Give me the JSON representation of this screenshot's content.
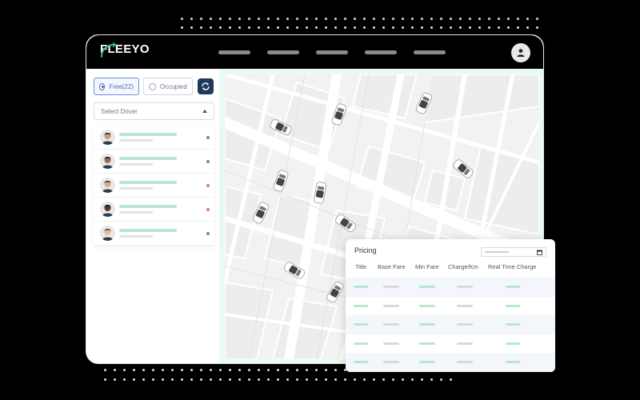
{
  "brand": {
    "name": "FLEEYO",
    "accent": "#2fbf8f"
  },
  "nav": {
    "item_count": 5
  },
  "sidebar": {
    "filters": [
      {
        "label": "Free(22)",
        "selected": true
      },
      {
        "label": "Occupied",
        "selected": false
      }
    ],
    "refresh_icon": "refresh-icon",
    "select_driver": {
      "placeholder": "Select Driver",
      "icon": "caret-up-icon"
    },
    "drivers": [
      {
        "status": "free",
        "status_color": "#4caf50",
        "skin": "#c69c7a",
        "hair": "#2b2118"
      },
      {
        "status": "free",
        "status_color": "#4caf50",
        "skin": "#9c6e4f",
        "hair": "#1a1410"
      },
      {
        "status": "occupied",
        "status_color": "#e57373",
        "skin": "#d8b090",
        "hair": "#3a2a1e"
      },
      {
        "status": "occupied",
        "status_color": "#e57373",
        "skin": "#5a3b28",
        "hair": "#111"
      },
      {
        "status": "free",
        "status_color": "#4caf50",
        "skin": "#e0c0a0",
        "hair": "#5a4030"
      }
    ]
  },
  "map": {
    "car_count": 12
  },
  "pricing": {
    "title": "Pricing",
    "date_icon": "calendar-icon",
    "columns": [
      "Title",
      "Base Fare",
      "Min Fare",
      "Charge/Km",
      "Real Time Charge"
    ],
    "row_count": 5
  }
}
